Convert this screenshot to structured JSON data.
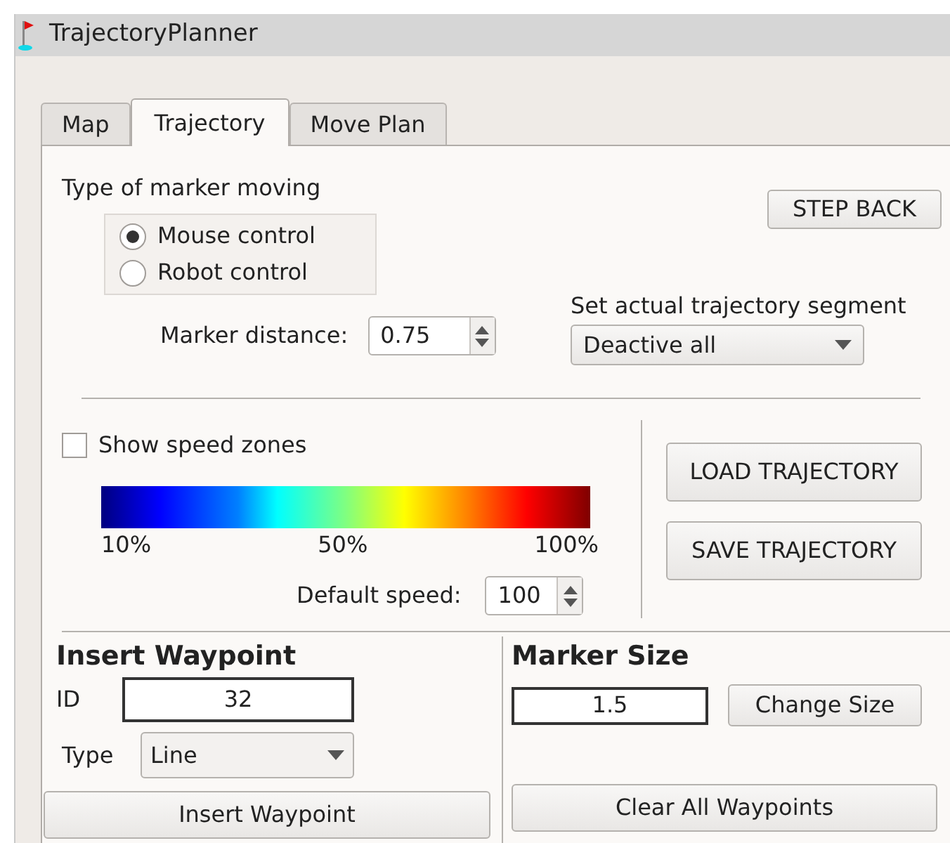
{
  "window": {
    "title": "TrajectoryPlanner"
  },
  "tabs": [
    {
      "label": "Map",
      "selected": false
    },
    {
      "label": "Trajectory",
      "selected": true
    },
    {
      "label": "Move Plan",
      "selected": false
    }
  ],
  "marker_moving": {
    "label": "Type of marker moving",
    "options": [
      {
        "label": "Mouse control",
        "selected": true
      },
      {
        "label": "Robot control",
        "selected": false
      }
    ]
  },
  "marker_distance": {
    "label": "Marker distance:",
    "value": "0.75"
  },
  "step_back_button": "STEP BACK",
  "segment": {
    "label": "Set actual trajectory segment",
    "value": "Deactive all"
  },
  "speed_zones": {
    "label": "Show speed zones",
    "checked": false
  },
  "speed_scale": [
    "10%",
    "50%",
    "100%"
  ],
  "default_speed": {
    "label": "Default speed:",
    "value": "100"
  },
  "load_button": "LOAD TRAJECTORY",
  "save_button": "SAVE TRAJECTORY",
  "insert_waypoint": {
    "title": "Insert Waypoint",
    "id_label": "ID",
    "id_value": "32",
    "type_label": "Type",
    "type_value": "Line",
    "button": "Insert Waypoint"
  },
  "marker_size": {
    "title": "Marker Size",
    "value": "1.5",
    "button": "Change Size",
    "clear_button": "Clear All Waypoints"
  }
}
